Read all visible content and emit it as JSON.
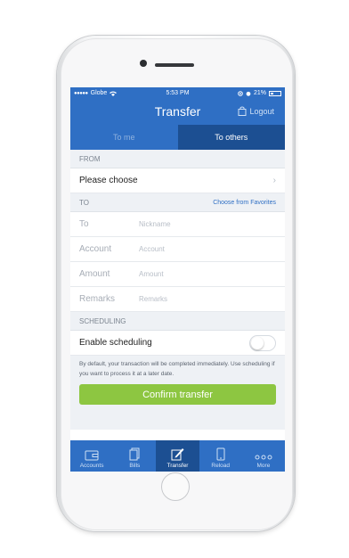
{
  "status": {
    "carrier": "Globe",
    "time": "5:53 PM",
    "battery": "21%"
  },
  "header": {
    "title": "Transfer",
    "logout": "Logout"
  },
  "segments": [
    {
      "label": "To me"
    },
    {
      "label": "To others"
    }
  ],
  "from": {
    "section": "FROM",
    "value": "Please choose"
  },
  "to": {
    "section": "TO",
    "favorites_link": "Choose from Favorites",
    "fields": [
      {
        "label": "To",
        "placeholder": "Nickname"
      },
      {
        "label": "Account",
        "placeholder": "Account"
      },
      {
        "label": "Amount",
        "placeholder": "Amount"
      },
      {
        "label": "Remarks",
        "placeholder": "Remarks"
      }
    ]
  },
  "scheduling": {
    "section": "SCHEDULING",
    "toggle_label": "Enable scheduling",
    "enabled": false,
    "note": "By default, your transaction will be completed immediately. Use scheduling if you want to process it at a later date."
  },
  "confirm_label": "Confirm transfer",
  "tabs": [
    {
      "label": "Accounts",
      "icon": "wallet-icon"
    },
    {
      "label": "Bills",
      "icon": "bills-icon"
    },
    {
      "label": "Transfer",
      "icon": "transfer-icon",
      "active": true
    },
    {
      "label": "Reload",
      "icon": "phone-icon"
    },
    {
      "label": "More",
      "icon": "more-icon"
    }
  ],
  "colors": {
    "primary": "#2f6fc4",
    "primary_dark": "#1c4f92",
    "confirm": "#8dc641"
  }
}
